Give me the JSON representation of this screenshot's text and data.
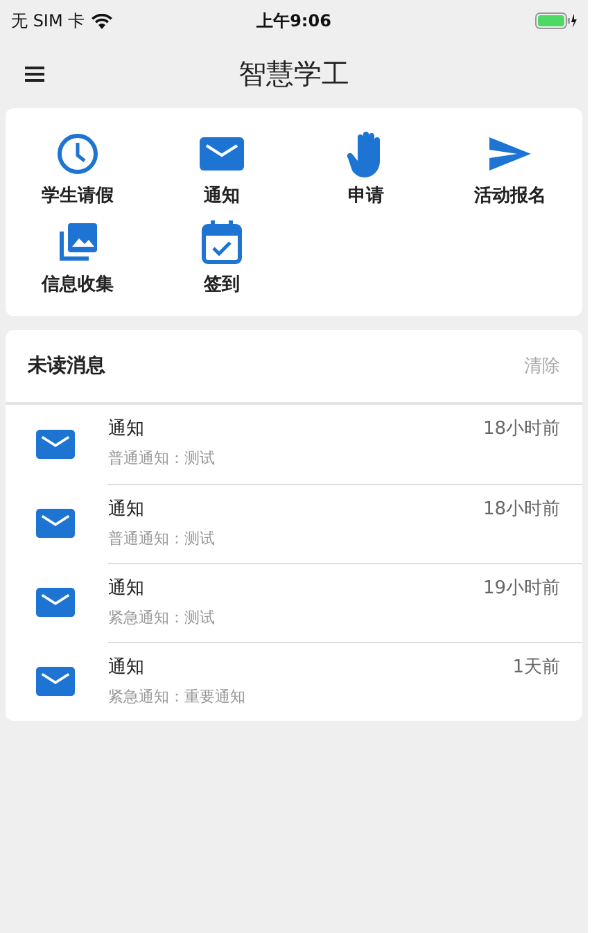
{
  "status_bar": {
    "carrier": "无 SIM 卡",
    "time": "上午9:06"
  },
  "nav": {
    "title": "智慧学工"
  },
  "menu": [
    {
      "label": "学生请假",
      "kind": "clock"
    },
    {
      "label": "通知",
      "kind": "mail"
    },
    {
      "label": "申请",
      "kind": "hand"
    },
    {
      "label": "活动报名",
      "kind": "send"
    },
    {
      "label": "信息收集",
      "kind": "photos"
    },
    {
      "label": "签到",
      "kind": "calendar"
    }
  ],
  "messages": {
    "title": "未读消息",
    "clear": "清除",
    "items": [
      {
        "title": "通知",
        "body": "普通通知：测试",
        "time": "18小时前"
      },
      {
        "title": "通知",
        "body": "普通通知：测试",
        "time": "18小时前"
      },
      {
        "title": "通知",
        "body": "紧急通知：测试",
        "time": "19小时前"
      },
      {
        "title": "通知",
        "body": "紧急通知：重要通知",
        "time": "1天前"
      }
    ]
  }
}
